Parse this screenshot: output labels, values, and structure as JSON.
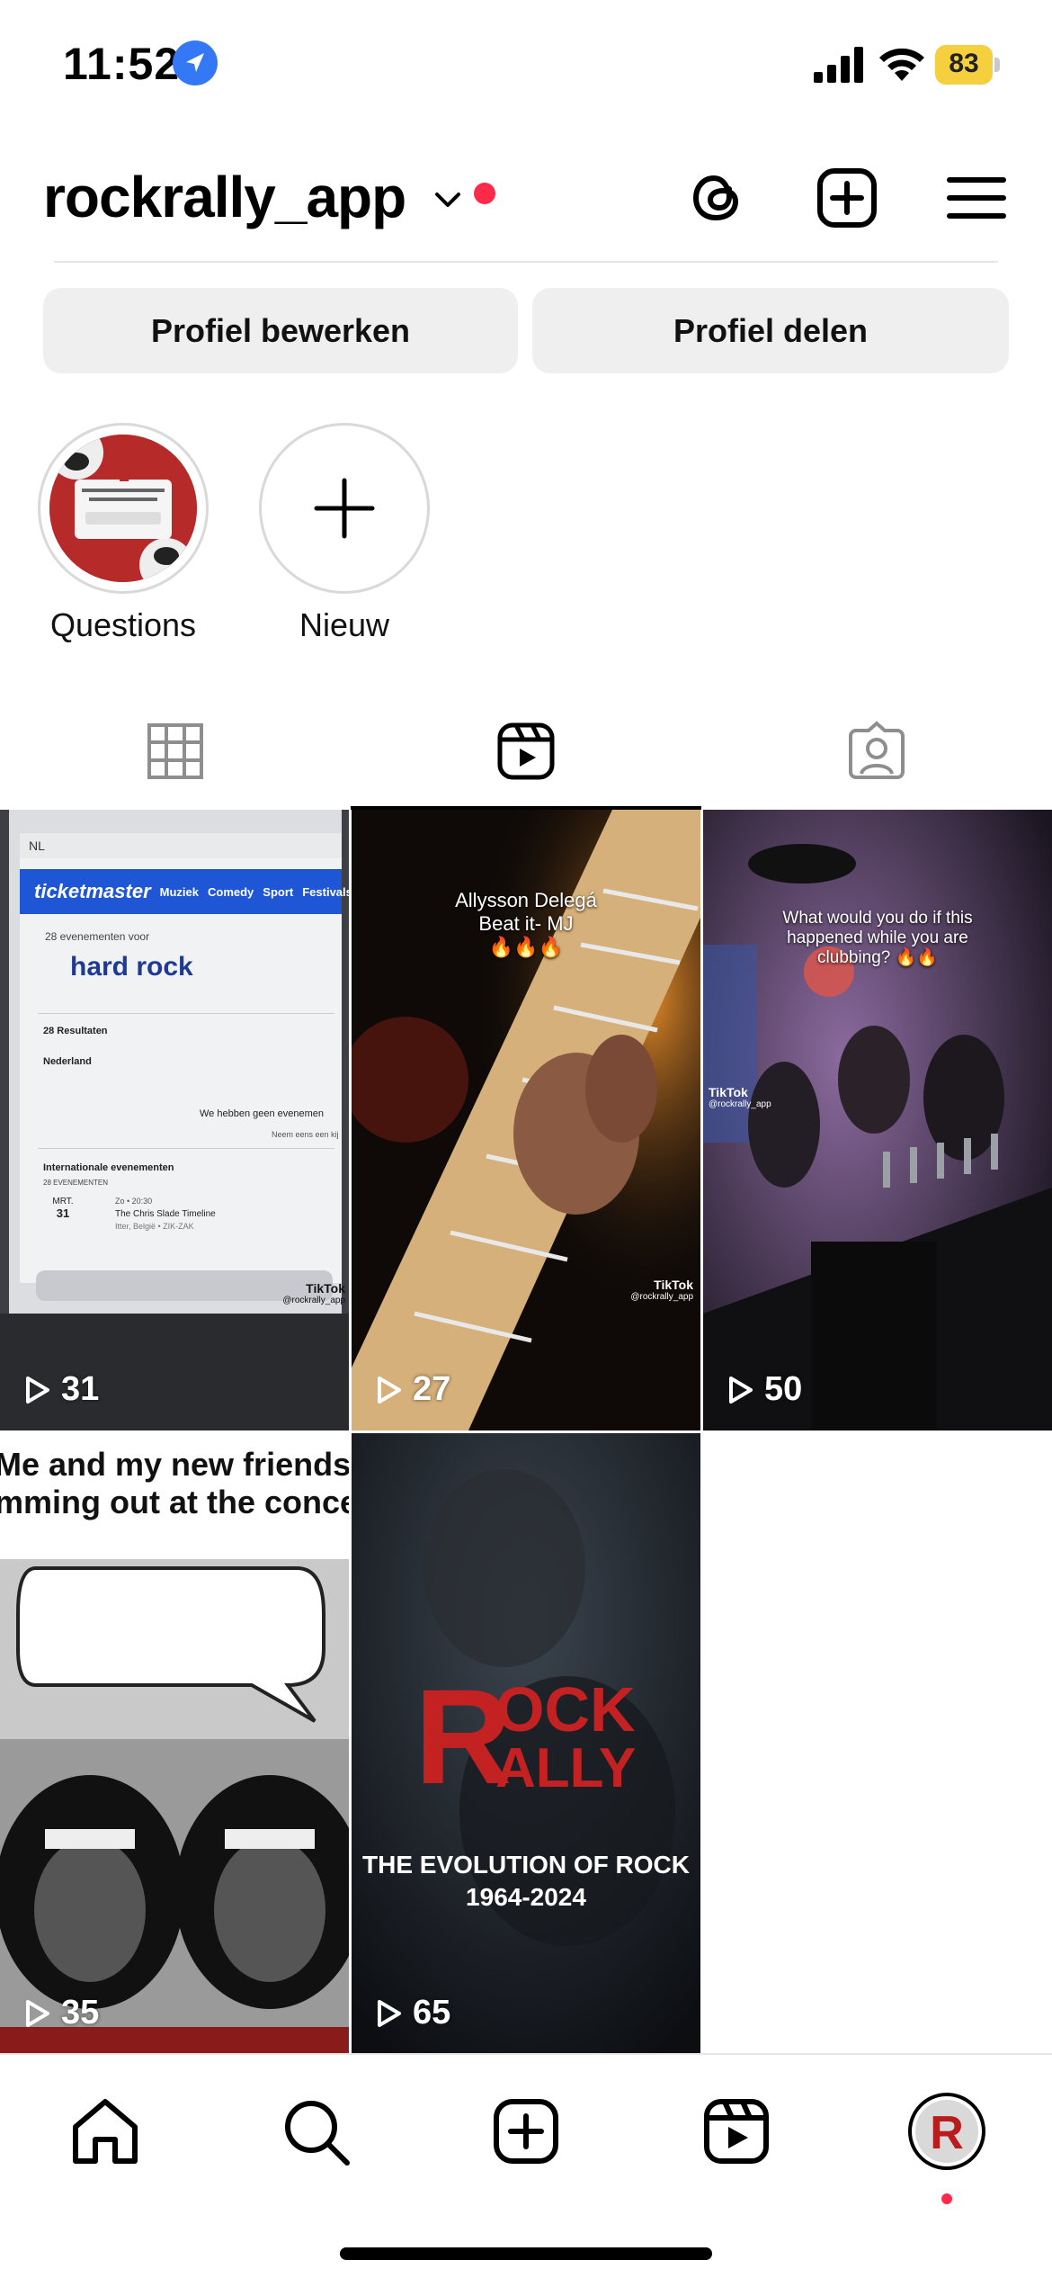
{
  "status_bar": {
    "time": "11:52",
    "battery": "83"
  },
  "header": {
    "username": "rockrally_app",
    "has_notification_dot": true
  },
  "profile_buttons": {
    "edit": "Profiel bewerken",
    "share": "Profiel delen"
  },
  "highlights": [
    {
      "label": "Questions",
      "icon": "story-thumbnail"
    },
    {
      "label": "Nieuw",
      "icon": "plus-icon"
    }
  ],
  "tabs": [
    {
      "name": "grid",
      "icon": "grid-icon",
      "active": false
    },
    {
      "name": "reels",
      "icon": "reels-icon",
      "active": true
    },
    {
      "name": "tagged",
      "icon": "tagged-icon",
      "active": false
    }
  ],
  "reels": [
    {
      "views": "31",
      "screen": {
        "brand": "ticketmaster",
        "nav": [
          "Muziek",
          "Comedy",
          "Sport",
          "Festivals"
        ],
        "locale": "NL",
        "count_label": "28 evenementen voor",
        "query": "hard rock",
        "results": "28 Resultaten",
        "country": "Nederland",
        "empty_msg": "We hebben geen evenemen",
        "empty_sub": "Neem eens een kij",
        "intl": "Internationale evenementen",
        "intl_count": "28 EVENEMENTEN",
        "event_month": "MRT.",
        "event_day": "31",
        "event_time": "Zo • 20:30",
        "event_title": "The Chris Slade Timeline",
        "event_place": "Itter, België • ZIK-ZAK"
      },
      "watermark": {
        "brand": "TikTok",
        "handle": "@rockrally_app"
      }
    },
    {
      "views": "27",
      "caption_line1": "Allysson Delegá",
      "caption_line2": "Beat it- MJ",
      "emoji": "🔥🔥🔥",
      "watermark": {
        "brand": "TikTok",
        "handle": "@rockrally_app"
      }
    },
    {
      "views": "50",
      "caption": "What would you do if this happened while you are clubbing? 🔥🔥",
      "watermark": {
        "brand": "TikTok",
        "handle": "@rockrally_app"
      }
    },
    {
      "views": "35",
      "caption_line1": "Me and my new friends",
      "caption_line2": "mming out at the conce"
    },
    {
      "views": "65",
      "logo_line1": "OCK",
      "logo_line2": "ALLY",
      "subtitle_line1": "THE EVOLUTION OF ROCK",
      "subtitle_line2": "1964-2024"
    }
  ],
  "bottom_nav": [
    {
      "name": "home",
      "icon": "home-icon"
    },
    {
      "name": "search",
      "icon": "search-icon"
    },
    {
      "name": "create",
      "icon": "plus-square-icon"
    },
    {
      "name": "reels",
      "icon": "reels-icon"
    },
    {
      "name": "profile",
      "icon": "avatar"
    }
  ],
  "colors": {
    "accent_red": "#ff2a4a",
    "button_bg": "#efefef",
    "location_blue": "#3478f6",
    "battery_yellow": "#f5cf3d"
  }
}
